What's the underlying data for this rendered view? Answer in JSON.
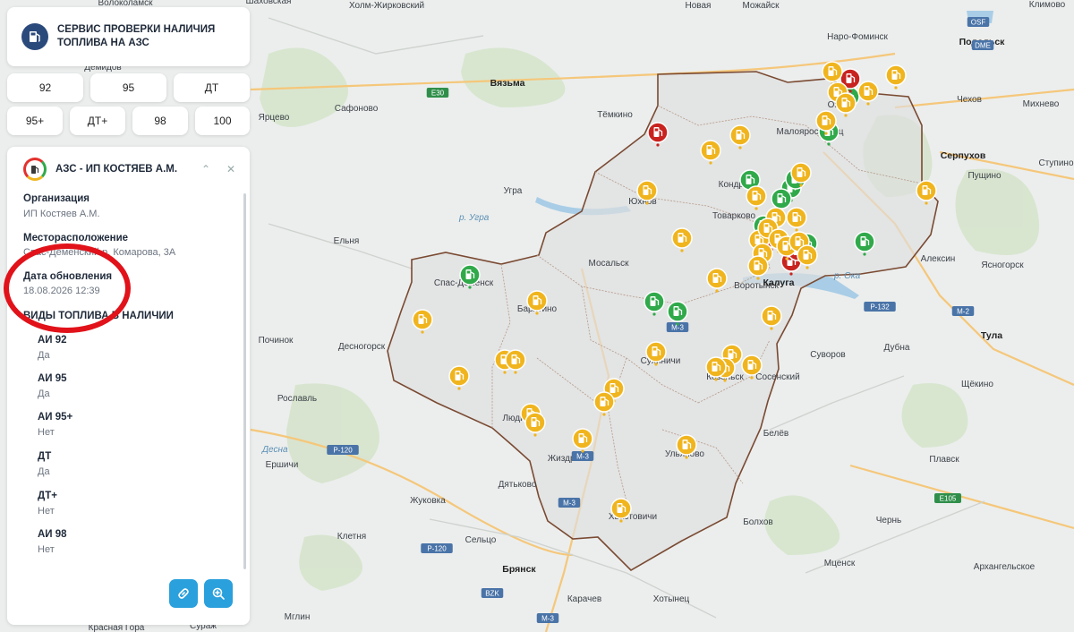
{
  "header": {
    "title": "СЕРВИС ПРОВЕРКИ НАЛИЧИЯ ТОПЛИВА НА АЗС"
  },
  "fuel_buttons": [
    "92",
    "95",
    "ДТ",
    "95+",
    "ДТ+",
    "98",
    "100"
  ],
  "station": {
    "name": "АЗС - ИП КОСТЯЕВ А.М.",
    "org_label": "Организация",
    "org_value": "ИП Костяев А.М.",
    "loc_label": "Месторасположение",
    "loc_value": "Спас-Деменский р, Комарова, 3А",
    "upd_label": "Дата обновления",
    "upd_value": "18.08.2026 12:39",
    "fuels_title": "ВИДЫ ТОПЛИВА В НАЛИЧИИ",
    "fuels": [
      {
        "name": "АИ 92",
        "status": "Да"
      },
      {
        "name": "АИ 95",
        "status": "Да"
      },
      {
        "name": "АИ 95+",
        "status": "Нет"
      },
      {
        "name": "ДТ",
        "status": "Да"
      },
      {
        "name": "ДТ+",
        "status": "Нет"
      },
      {
        "name": "АИ 98",
        "status": "Нет"
      }
    ]
  },
  "map": {
    "places": [
      "Холм-Жирковский",
      "Новая",
      "Можайск",
      "Наро-Фоминск",
      "Подольск",
      "Демидов",
      "Вязьма",
      "Сафоново",
      "Ярцево",
      "Тёмкино",
      "Малоярославец",
      "Чехов",
      "Михнево",
      "Угра",
      "Юхнов",
      "Товарково",
      "Кондрово",
      "Серпухов",
      "Пущино",
      "Ступино",
      "Ельня",
      "Спас-Деменск",
      "Мосальск",
      "Воротынск",
      "Калуга",
      "Алексин",
      "Ясногорск",
      "Барятино",
      "Починок",
      "Рославль",
      "Десногорск",
      "Сухиничи",
      "Козельск",
      "Сосенский",
      "Суворов",
      "Дубна",
      "Тула",
      "Щёкино",
      "Людиново",
      "Белёв",
      "Ершичи",
      "Жиздра",
      "Ульяново",
      "Плавск",
      "Дятьково",
      "Жуковка",
      "Хвастовичи",
      "Болхов",
      "Чернь",
      "Клетня",
      "Сельцо",
      "Брянск",
      "Мценск",
      "Архангельское",
      "Карачев",
      "Хотынец",
      "Мглин",
      "Красная Гора",
      "Сураж",
      "Климово",
      "Волоколамск",
      "Шаховская",
      "Озёры"
    ],
    "roads": [
      "E30",
      "P-132",
      "M-2",
      "M-3",
      "P-120",
      "E105",
      "OSF",
      "DME",
      "BZK"
    ],
    "rivers": [
      "р. Угра",
      "р. Ока",
      "Десна"
    ],
    "marker_colors": {
      "available": "#30a94a",
      "partial": "#f0b51e",
      "unavailable": "#c8231f"
    },
    "icon": "fuel-pump-icon"
  },
  "actions": {
    "link": "link-icon",
    "zoom": "zoom-in-icon"
  }
}
